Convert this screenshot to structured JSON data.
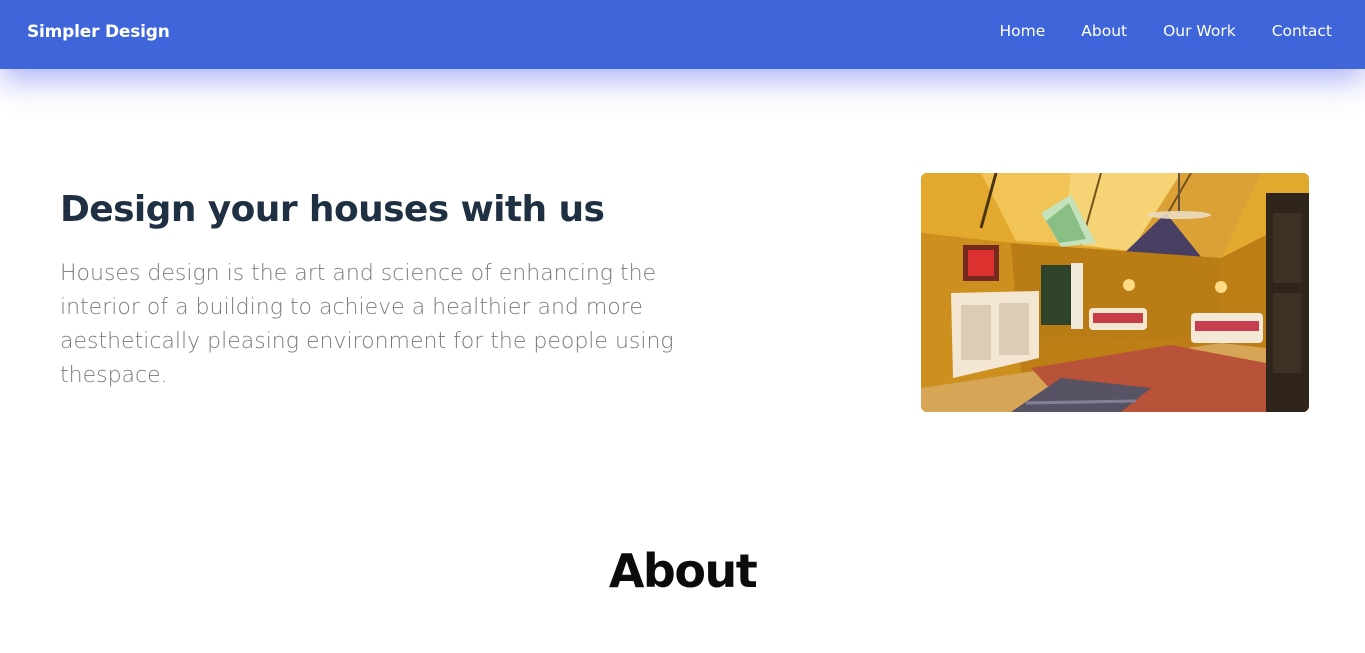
{
  "colors": {
    "accent": "#3e65d9",
    "heading": "#1f3043",
    "body_text": "#7b7b7b"
  },
  "navbar": {
    "brand": "Simpler Design",
    "links": [
      {
        "label": "Home"
      },
      {
        "label": "About"
      },
      {
        "label": "Our Work"
      },
      {
        "label": "Contact"
      }
    ]
  },
  "hero": {
    "title": "Design your houses with us",
    "description": "Houses design is the art and science of enhancing the interior of a building to achieve a healthier and more aesthetically pleasing environment for the people using thespace."
  },
  "about": {
    "heading": "About"
  }
}
